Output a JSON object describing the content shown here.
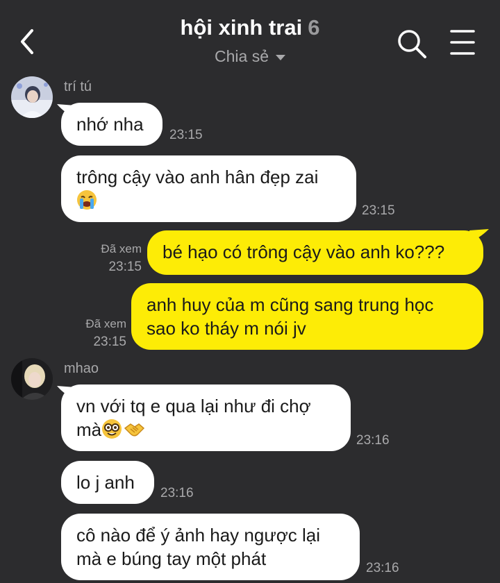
{
  "header": {
    "title": "hội xinh trai",
    "member_count": "6",
    "subtitle": "Chia sẻ",
    "icons": [
      "back-chevron-icon",
      "search-icon",
      "menu-icon",
      "dropdown-caret-icon"
    ]
  },
  "colors": {
    "background": "#2c2c2e",
    "incoming_bubble": "#ffffff",
    "outgoing_bubble": "#fdec06",
    "muted_text": "#a9a9ab"
  },
  "messages": [
    {
      "sender": "trí tú",
      "text": "nhớ nha",
      "time": "23:15"
    },
    {
      "text": "trông cậy vào anh hân đẹp zai",
      "emoji": [
        "loudly-crying-face-emoji"
      ],
      "time": "23:15"
    },
    {
      "text": "bé hạo có trông cậy vào anh ko???",
      "status": "Đã xem",
      "time": "23:15"
    },
    {
      "text_line1": "anh huy của m cũng sang trung học",
      "text_line2": "sao ko tháy m nói jv",
      "status": "Đã xem",
      "time": "23:15"
    },
    {
      "sender": "mhao",
      "text_line1": "vn với tq e qua lại như đi chợ",
      "text_line2": "mà",
      "emoji": [
        "nerd-face-emoji",
        "handshake-emoji"
      ],
      "time": "23:16"
    },
    {
      "text": "lo j anh",
      "time": "23:16"
    },
    {
      "text_line1": "cô nào để ý ảnh hay ngược lại",
      "text_line2": "mà e búng tay một phát",
      "time": "23:16"
    }
  ]
}
